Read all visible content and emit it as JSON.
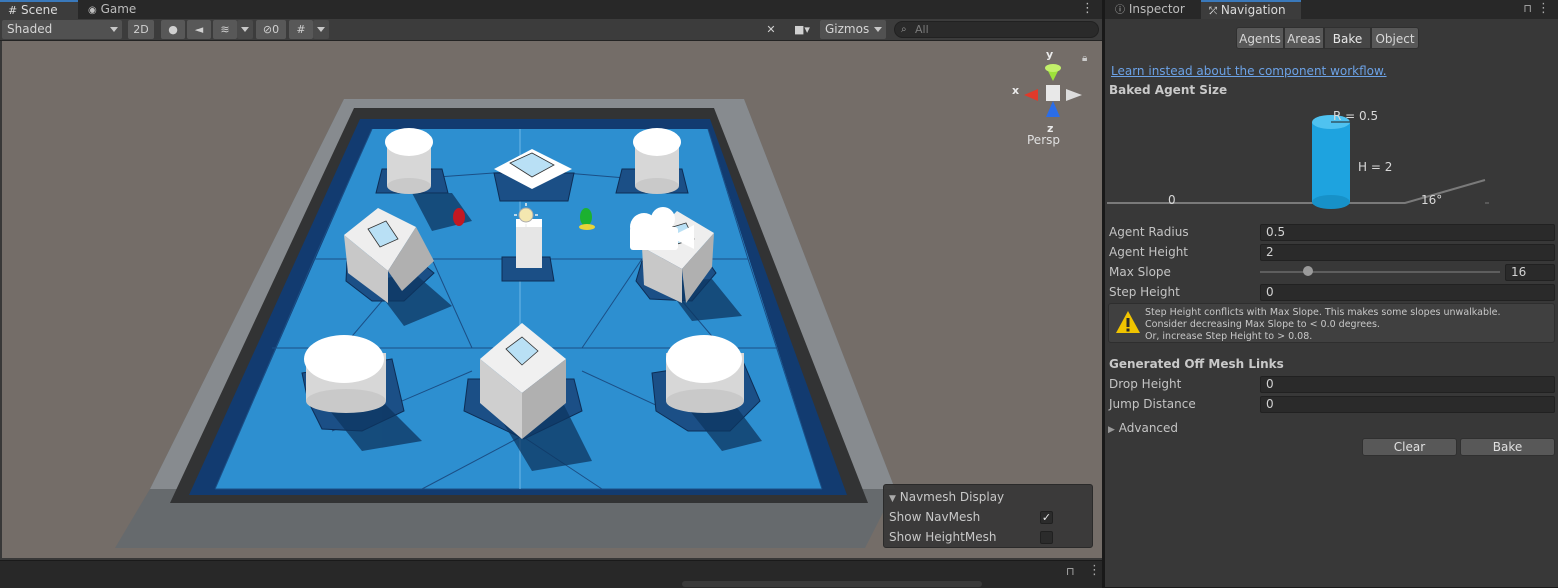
{
  "scene_tabs": [
    {
      "label": "Scene"
    },
    {
      "label": "Game"
    }
  ],
  "toolbar": {
    "shading_mode": "Shaded",
    "mode_2d": "2D",
    "hidden_count": "0",
    "gizmos_label": "Gizmos",
    "search_placeholder": "All"
  },
  "gizmo": {
    "y": "y",
    "x": "x",
    "z": "z",
    "projection": "Persp"
  },
  "navmesh_display": {
    "title": "Navmesh Display",
    "show_navmesh_label": "Show NavMesh",
    "show_navmesh_checked": true,
    "show_heightmesh_label": "Show HeightMesh",
    "show_heightmesh_checked": false
  },
  "inspector_tabs": [
    {
      "label": "Inspector"
    },
    {
      "label": "Navigation"
    }
  ],
  "nav_segments": [
    {
      "label": "Agents"
    },
    {
      "label": "Areas"
    },
    {
      "label": "Bake"
    },
    {
      "label": "Object"
    }
  ],
  "bake": {
    "component_link": "Learn instead about the component workflow.",
    "baked_agent_size_header": "Baked Agent Size",
    "diagram": {
      "radius_label": "R = 0.5",
      "height_label": "H = 2",
      "step_label": "0",
      "slope_label": "16°",
      "agent_color": "#1ea3df"
    },
    "agent_radius_label": "Agent Radius",
    "agent_radius": "0.5",
    "agent_height_label": "Agent Height",
    "agent_height": "2",
    "max_slope_label": "Max Slope",
    "max_slope": "16",
    "max_slope_fraction": 0.2,
    "step_height_label": "Step Height",
    "step_height": "0",
    "warning_lines": [
      "Step Height conflicts with Max Slope. This makes some slopes unwalkable.",
      "Consider decreasing Max Slope to < 0.0 degrees.",
      "Or, increase Step Height to > 0.08."
    ],
    "offmesh_header": "Generated Off Mesh Links",
    "drop_height_label": "Drop Height",
    "drop_height": "0",
    "jump_distance_label": "Jump Distance",
    "jump_distance": "0",
    "advanced_label": "Advanced",
    "clear_label": "Clear",
    "bake_label": "Bake"
  },
  "colors": {
    "navmesh": "#2d8fd0",
    "floor_dark": "#123b70",
    "accent": "#3a79bb",
    "warning": "#f0c400",
    "link": "#6ca2e6"
  }
}
